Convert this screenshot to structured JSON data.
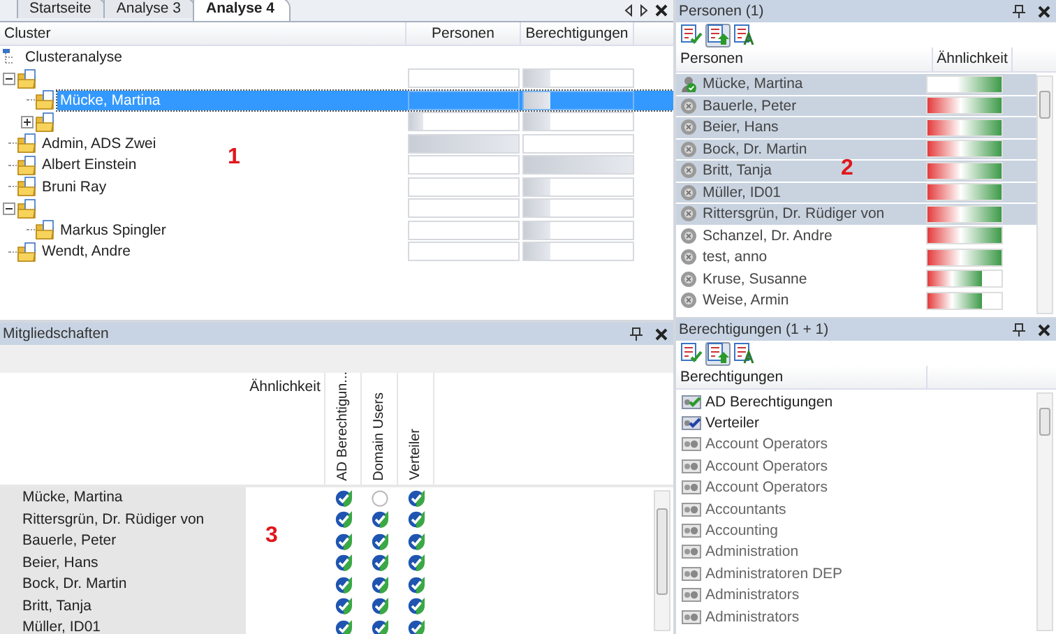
{
  "tabs": [
    {
      "label": "Startseite",
      "selected": false
    },
    {
      "label": "Analyse 3",
      "selected": false
    },
    {
      "label": "Analyse 4",
      "selected": true
    }
  ],
  "cluster_panel": {
    "columns": [
      "Cluster",
      "Personen",
      "Berechtigungen"
    ],
    "annotation": "1",
    "tree": {
      "label": "Clusteranalyse",
      "children": [
        {
          "expanded": true,
          "selected": false,
          "personen": {
            "level": 0
          },
          "berechtigungen": {
            "level": 0.24
          },
          "children": [
            {
              "label": "Mücke, Martina",
              "selected": true,
              "personen": {
                "level": 0
              },
              "berechtigungen": {
                "level": 0.24
              }
            },
            {
              "expanded": false,
              "selected": false,
              "personen": {
                "level": 0.13
              },
              "berechtigungen": {
                "level": 0.24
              }
            }
          ]
        },
        {
          "label": "Admin, ADS Zwei",
          "selected": false,
          "personen": {
            "level": 1
          },
          "berechtigungen": {
            "level": 0
          }
        },
        {
          "label": "Albert Einstein",
          "selected": false,
          "personen": {
            "level": 0
          },
          "berechtigungen": {
            "level": 1
          }
        },
        {
          "label": "Bruni Ray",
          "selected": false,
          "personen": {
            "level": 0
          },
          "berechtigungen": {
            "level": 0.24
          }
        },
        {
          "expanded": true,
          "selected": false,
          "personen": {
            "level": 0
          },
          "berechtigungen": {
            "level": 0.24
          },
          "children": [
            {
              "label": "Markus Spingler",
              "selected": false,
              "personen": {
                "level": 0
              },
              "berechtigungen": {
                "level": 0.24
              }
            }
          ]
        },
        {
          "label": "Wendt, Andre",
          "selected": false,
          "personen": {
            "level": 0
          },
          "berechtigungen": {
            "level": 0.24
          }
        }
      ]
    }
  },
  "memberships_panel": {
    "title": "Mitgliedschaften",
    "similarity_column": "Ähnlichkeit",
    "annotation": "3",
    "columns": [
      "AD Berechtigun...",
      "Domain Users",
      "Verteiler"
    ],
    "rows": [
      {
        "name": "Mücke, Martina",
        "values": [
          true,
          false,
          true
        ]
      },
      {
        "name": "Rittersgrün, Dr. Rüdiger von",
        "values": [
          true,
          true,
          true
        ]
      },
      {
        "name": "Bauerle, Peter",
        "values": [
          true,
          true,
          true
        ]
      },
      {
        "name": "Beier, Hans",
        "values": [
          true,
          true,
          true
        ]
      },
      {
        "name": "Bock, Dr. Martin",
        "values": [
          true,
          true,
          true
        ]
      },
      {
        "name": "Britt, Tanja",
        "values": [
          true,
          true,
          true
        ]
      },
      {
        "name": "Müller, ID01",
        "values": [
          true,
          true,
          true
        ]
      }
    ]
  },
  "persons_panel": {
    "title": "Personen (1)",
    "columns": [
      "Personen",
      "Ähnlichkeit"
    ],
    "annotation": "2",
    "toolbar": [
      {
        "pressed": false
      },
      {
        "pressed": true
      },
      {
        "pressed": false
      }
    ],
    "rows": [
      {
        "name": "Mücke, Martina",
        "kind": "reference",
        "highlighted": true,
        "level": 1
      },
      {
        "name": "Bauerle, Peter",
        "kind": "person",
        "highlighted": true,
        "level": 1
      },
      {
        "name": "Beier, Hans",
        "kind": "person",
        "highlighted": true,
        "level": 1
      },
      {
        "name": "Bock, Dr. Martin",
        "kind": "person",
        "highlighted": true,
        "level": 1
      },
      {
        "name": "Britt, Tanja",
        "kind": "person",
        "highlighted": true,
        "level": 1
      },
      {
        "name": "Müller, ID01",
        "kind": "person",
        "highlighted": true,
        "level": 1
      },
      {
        "name": "Rittersgrün, Dr. Rüdiger von",
        "kind": "person",
        "highlighted": true,
        "level": 1
      },
      {
        "name": "Schanzel, Dr. Andre",
        "kind": "person",
        "highlighted": false,
        "level": 1
      },
      {
        "name": "test, anno",
        "kind": "person",
        "highlighted": false,
        "level": 1
      },
      {
        "name": "Kruse, Susanne",
        "kind": "person",
        "highlighted": false,
        "level": 0.73
      },
      {
        "name": "Weise, Armin",
        "kind": "person",
        "highlighted": false,
        "level": 0.73
      }
    ]
  },
  "permissions_panel": {
    "title": "Berechtigungen (1 + 1)",
    "columns": [
      "Berechtigungen"
    ],
    "toolbar": [
      {
        "pressed": false
      },
      {
        "pressed": true
      },
      {
        "pressed": false
      }
    ],
    "items": [
      {
        "label": "AD Berechtigungen",
        "kind": "assigned"
      },
      {
        "label": "Verteiler",
        "kind": "checked"
      },
      {
        "label": "Account Operators",
        "kind": "group"
      },
      {
        "label": "Account Operators",
        "kind": "group"
      },
      {
        "label": "Account Operators",
        "kind": "group"
      },
      {
        "label": "Accountants",
        "kind": "group"
      },
      {
        "label": "Accounting",
        "kind": "group"
      },
      {
        "label": "Administration",
        "kind": "group"
      },
      {
        "label": "Administratoren DEP",
        "kind": "group"
      },
      {
        "label": "Administrators",
        "kind": "group"
      },
      {
        "label": "Administrators",
        "kind": "group"
      }
    ]
  }
}
